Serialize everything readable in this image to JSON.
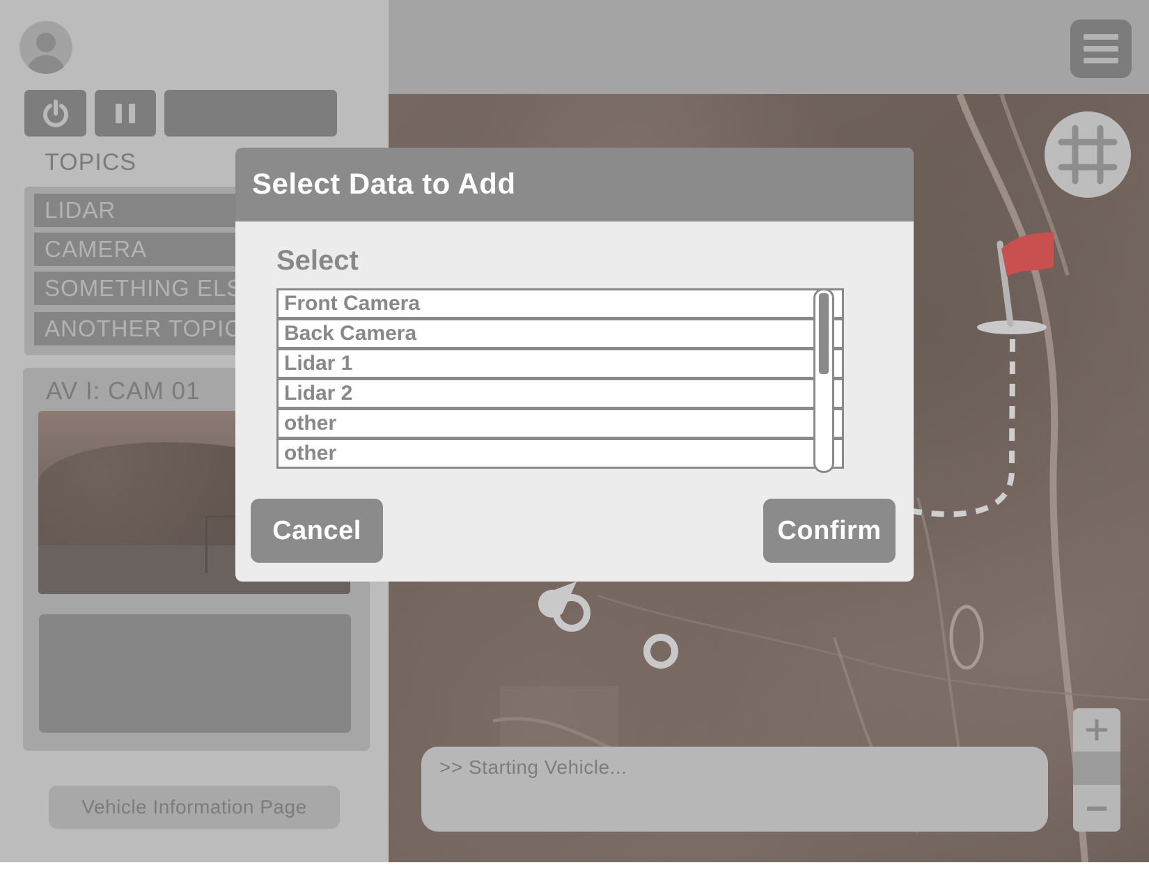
{
  "sidebar": {
    "topics_title": "TOPICS",
    "topics": [
      "LIDAR",
      "CAMERA",
      "SOMETHING ELSE",
      "ANOTHER TOPIC"
    ],
    "camera_title": "AV I: CAM 01",
    "vehicle_info_label": "Vehicle Information Page"
  },
  "console": {
    "text": ">> Starting Vehicle..."
  },
  "modal": {
    "title": "Select Data to Add",
    "select_label": "Select",
    "options": [
      "Front Camera",
      "Back Camera",
      "Lidar 1",
      "Lidar 2",
      "other",
      "other"
    ],
    "cancel_label": "Cancel",
    "confirm_label": "Confirm"
  },
  "icons": {
    "power": "power-icon",
    "pause": "pause-icon",
    "menu": "hamburger-menu-icon",
    "grid": "grid-icon",
    "flag": "flag-icon",
    "zoom_in": "plus-icon",
    "zoom_out": "minus-icon"
  },
  "colors": {
    "flag": "#c8504f",
    "modal_header": "#8b8b8b",
    "modal_body": "#ececec",
    "sidebar": "#bcbcbc"
  }
}
